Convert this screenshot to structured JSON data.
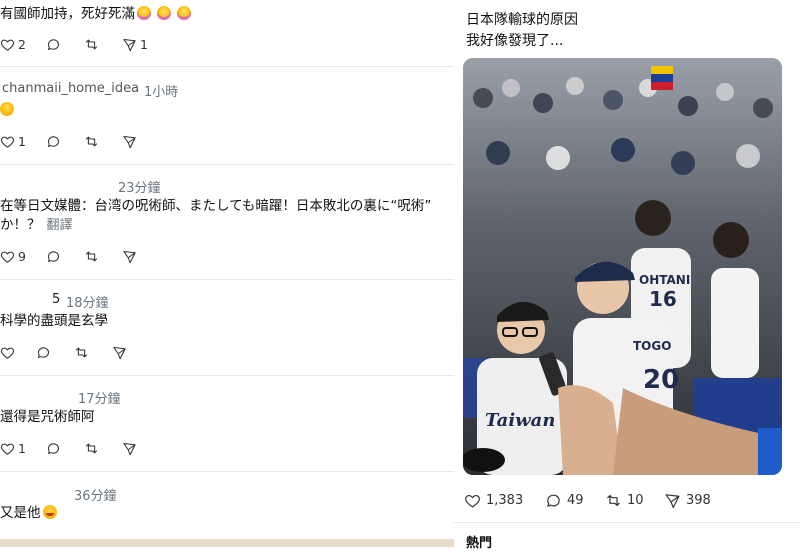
{
  "replies": [
    {
      "text": "有國師加持，死好死滿",
      "emoji": [
        "pink-face-icon",
        "pink-face-icon",
        "pink-face-icon"
      ],
      "actions": {
        "likes": "2",
        "replies": "",
        "retweets": "",
        "views": "1"
      }
    },
    {
      "name": "chanmaii_home_idea",
      "time": "1小時",
      "text": "",
      "emoji": [
        "laughing-face-icon"
      ],
      "actions": {
        "likes": "1",
        "replies": "",
        "retweets": "",
        "views": ""
      }
    },
    {
      "name": "",
      "time": "23分鐘",
      "text": "在等日文媒體：台湾の呪術師、またしても暗躍！日本敗北の裏に“呪術”",
      "text2": "か！？",
      "translate": "翻譯",
      "actions": {
        "likes": "9",
        "replies": "",
        "retweets": "",
        "views": ""
      }
    },
    {
      "name": "5",
      "time": "18分鐘",
      "text": "科學的盡頭是玄學",
      "actions": {
        "likes": "",
        "replies": "",
        "retweets": "",
        "views": ""
      }
    },
    {
      "name": "",
      "time": "17分鐘",
      "text": "還得是咒術師阿",
      "actions": {
        "likes": "1",
        "replies": "",
        "retweets": "",
        "views": ""
      }
    },
    {
      "name": "",
      "time": "36分鐘",
      "text": "又是他",
      "emoji": [
        "rofl-face-icon"
      ]
    }
  ],
  "post": {
    "line1": "日本隊輸球的原因",
    "line2": "我好像發現了...",
    "stats": {
      "likes": "1,383",
      "replies": "49",
      "retweets": "10",
      "views": "398"
    },
    "below": "熱門"
  },
  "photo": {
    "jersey_left": "Taiwan",
    "jersey_center_name": "TOGO",
    "jersey_center_number": "20",
    "jersey_right_name": "OHTANI",
    "jersey_right_number": "16"
  }
}
